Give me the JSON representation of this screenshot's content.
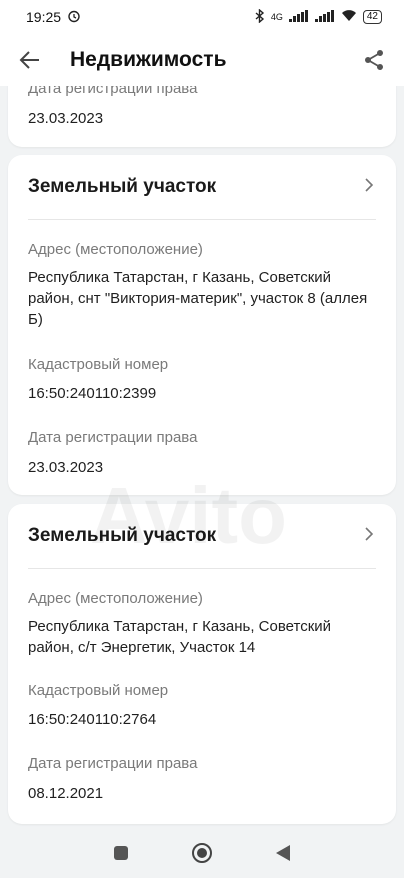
{
  "status_bar": {
    "time": "19:25",
    "network": "4G",
    "battery": "42"
  },
  "app_bar": {
    "title": "Недвижимость"
  },
  "top_card": {
    "label": "Дата регистрации права",
    "value": "23.03.2023"
  },
  "cards": [
    {
      "title": "Земельный участок",
      "address_label": "Адрес (местоположение)",
      "address": "Республика Татарстан, г Казань, Советский район, снт \"Виктория-материк\", участок 8 (аллея Б)",
      "cadastral_label": "Кадастровый номер",
      "cadastral": "16:50:240110:2399",
      "date_label": "Дата регистрации права",
      "date": "23.03.2023"
    },
    {
      "title": "Земельный участок",
      "address_label": "Адрес (местоположение)",
      "address": "Республика Татарстан, г Казань, Советский район, с/т Энергетик, Участок 14",
      "cadastral_label": "Кадастровый номер",
      "cadastral": "16:50:240110:2764",
      "date_label": "Дата регистрации права",
      "date": "08.12.2021"
    }
  ],
  "watermark": "Avito",
  "icons": {
    "back": "arrow-left",
    "share": "share",
    "chevron": "chevron-right",
    "alarm": "alarm-clock",
    "bluetooth": "bluetooth",
    "signal": "signal",
    "wifi": "wifi",
    "nav_recents": "square",
    "nav_home": "circle",
    "nav_back": "triangle"
  }
}
